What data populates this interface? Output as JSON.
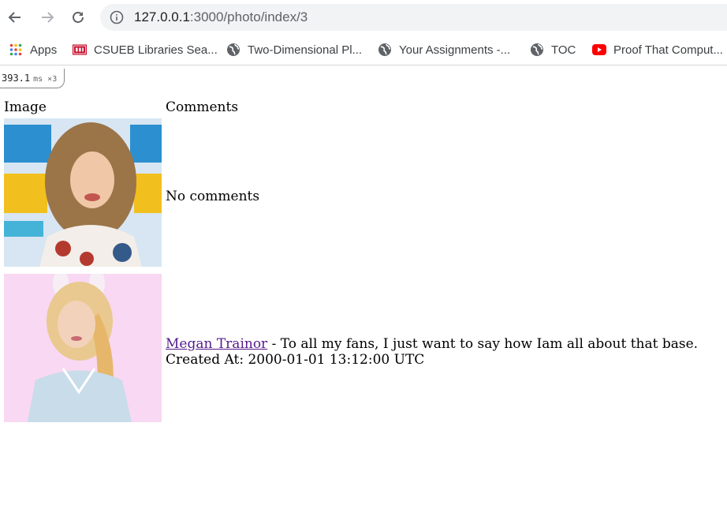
{
  "browser": {
    "url_host": "127.0.0.1",
    "url_path": ":3000/photo/index/3",
    "bookmarks": [
      {
        "label": "Apps",
        "icon": "apps-grid-icon"
      },
      {
        "label": "CSUEB Libraries Sea...",
        "icon": "csu-logo-icon"
      },
      {
        "label": "Two-Dimensional Pl...",
        "icon": "globe-icon"
      },
      {
        "label": "Your Assignments -...",
        "icon": "globe-icon"
      },
      {
        "label": "TOC",
        "icon": "globe-icon"
      },
      {
        "label": "Proof That Comput...",
        "icon": "youtube-icon"
      }
    ]
  },
  "profiler": {
    "time": "393.1",
    "unit": "ms",
    "count": "×3"
  },
  "table": {
    "headers": [
      "Image",
      "Comments"
    ],
    "rows": [
      {
        "comment_text": "No comments"
      },
      {
        "author": "Megan Trainor",
        "comment": " - To all my fans, I just want to say how Iam all about that base.",
        "created_at": "Created At: 2000-01-01 13:12:00 UTC"
      }
    ]
  },
  "colors": {
    "link_visited": "#551a8b",
    "omnibox": "#f1f3f4",
    "csu_red": "#c8102e",
    "youtube_red": "#ff0000"
  }
}
